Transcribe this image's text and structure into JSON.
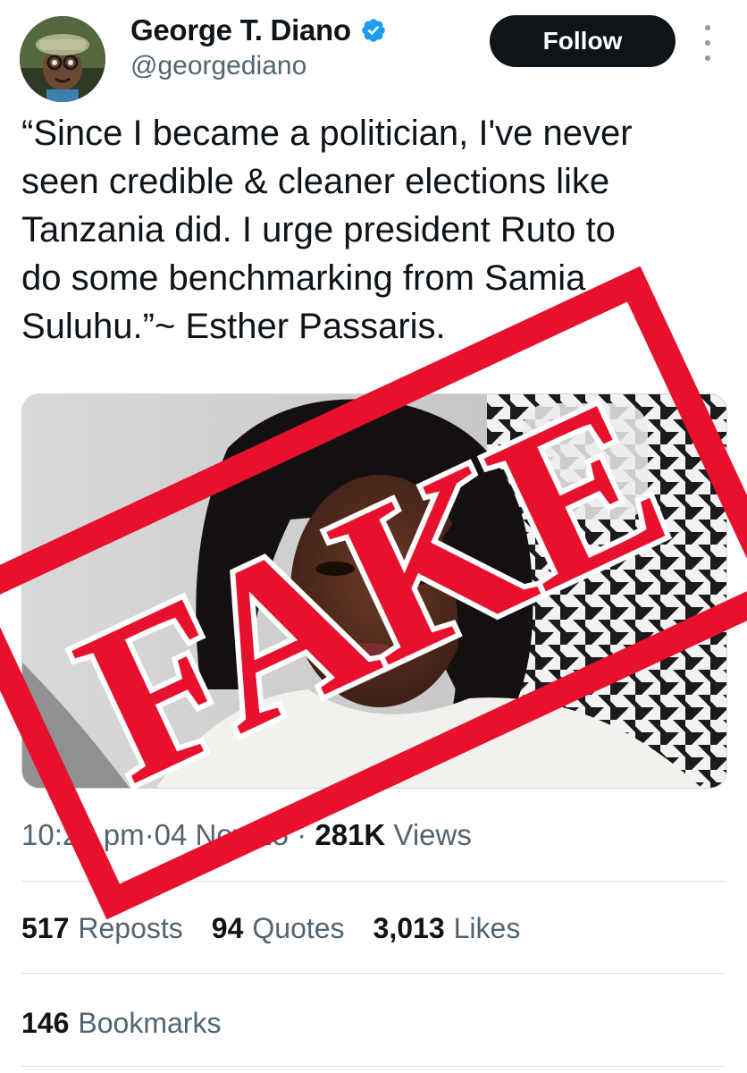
{
  "author": {
    "display_name": "George T. Diano",
    "handle": "@georgediano",
    "verified": true,
    "avatar_icon": "cartoon-character-avatar"
  },
  "header": {
    "follow_label": "Follow",
    "more_icon": "vertical-ellipsis-icon"
  },
  "tweet": {
    "text": "“Since I became a politician, I've never\nseen credible & cleaner elections like\nTanzania did. I urge president Ruto to\ndo some benchmarking from Samia\nSuluhu.”~ Esther Passaris."
  },
  "meta": {
    "time": "10:21 pm",
    "separator": " · ",
    "date": "04 Nov 25",
    "views_count": "281K",
    "views_label": "Views"
  },
  "stats": [
    {
      "num": "517",
      "label": "Reposts"
    },
    {
      "num": "94",
      "label": "Quotes"
    },
    {
      "num": "3,013",
      "label": "Likes"
    }
  ],
  "bookmarks": {
    "num": "146",
    "label": "Bookmarks"
  },
  "stamp": {
    "text": "FAKE",
    "color": "#e8112d"
  },
  "colors": {
    "text_primary": "#0f1419",
    "text_secondary": "#536471",
    "verified_blue": "#1d9bf0",
    "follow_bg": "#0f1419"
  }
}
